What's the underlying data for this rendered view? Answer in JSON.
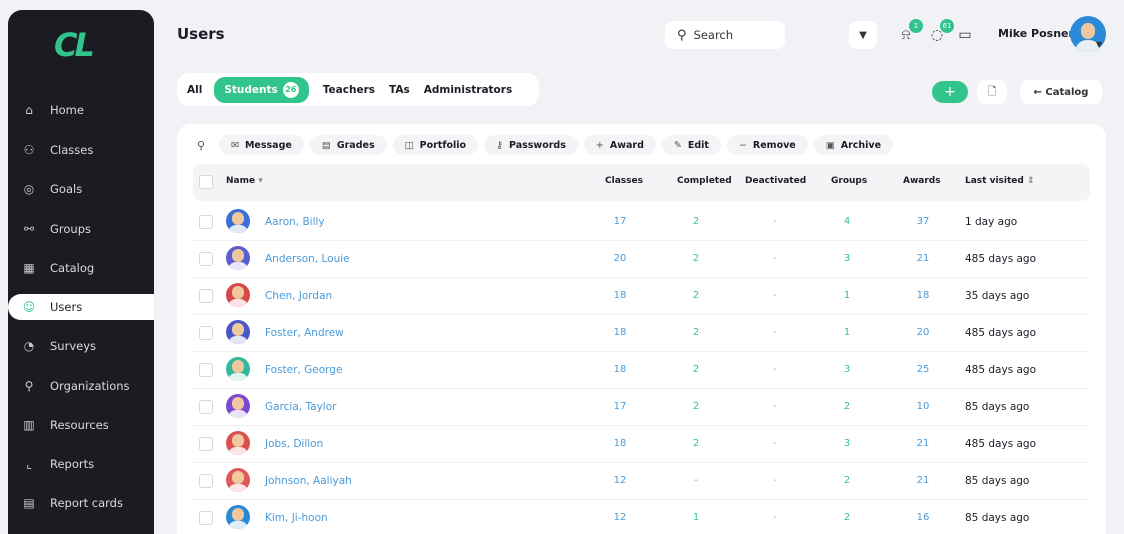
{
  "app": {
    "logo": "CL",
    "page_title": "Users"
  },
  "sidebar": {
    "items": [
      {
        "label": "Home",
        "icon": "home-icon",
        "glyph": "⌂"
      },
      {
        "label": "Classes",
        "icon": "classes-icon",
        "glyph": "⚇"
      },
      {
        "label": "Goals",
        "icon": "goals-icon",
        "glyph": "◎"
      },
      {
        "label": "Groups",
        "icon": "groups-icon",
        "glyph": "⚯"
      },
      {
        "label": "Catalog",
        "icon": "catalog-icon",
        "glyph": "▦"
      },
      {
        "label": "Users",
        "icon": "user-icon",
        "glyph": "☺",
        "active": true
      },
      {
        "label": "Surveys",
        "icon": "surveys-icon",
        "glyph": "◔"
      },
      {
        "label": "Organizations",
        "icon": "organizations-icon",
        "glyph": "⚲"
      },
      {
        "label": "Resources",
        "icon": "resources-icon",
        "glyph": "▥"
      },
      {
        "label": "Reports",
        "icon": "reports-icon",
        "glyph": "⌞"
      },
      {
        "label": "Report cards",
        "icon": "report-cards-icon",
        "glyph": "▤"
      }
    ]
  },
  "header": {
    "search_label": "Search",
    "user_name": "Mike Posner",
    "notif_badge_1": "1",
    "notif_badge_2": "61"
  },
  "role_tabs": {
    "all": "All",
    "students": "Students",
    "students_count": "26",
    "teachers": "Teachers",
    "tas": "TAs",
    "administrators": "Administrators"
  },
  "actions": {
    "add": "+",
    "catalog": "← Catalog"
  },
  "toolbar": {
    "message": "Message",
    "grades": "Grades",
    "portfolio": "Portfolio",
    "passwords": "Passwords",
    "award": "Award",
    "edit": "Edit",
    "remove": "Remove",
    "archive": "Archive"
  },
  "table": {
    "headers": {
      "name": "Name",
      "classes": "Classes",
      "completed": "Completed",
      "deactivated": "Deactivated",
      "groups": "Groups",
      "awards": "Awards",
      "last_visited": "Last visited"
    },
    "rows": [
      {
        "name": "Aaron, Billy",
        "classes": "17",
        "completed": "2",
        "deactivated": "-",
        "groups": "4",
        "awards": "37",
        "last_visited": "1 day ago",
        "color": "#3b6fd8"
      },
      {
        "name": "Anderson, Louie",
        "classes": "20",
        "completed": "2",
        "deactivated": "-",
        "groups": "3",
        "awards": "21",
        "last_visited": "485 days ago",
        "color": "#5a5fd0"
      },
      {
        "name": "Chen, Jordan",
        "classes": "18",
        "completed": "2",
        "deactivated": "-",
        "groups": "1",
        "awards": "18",
        "last_visited": "35 days ago",
        "color": "#d84848"
      },
      {
        "name": "Foster, Andrew",
        "classes": "18",
        "completed": "2",
        "deactivated": "-",
        "groups": "1",
        "awards": "20",
        "last_visited": "485 days ago",
        "color": "#4a55c8"
      },
      {
        "name": "Foster, George",
        "classes": "18",
        "completed": "2",
        "deactivated": "-",
        "groups": "3",
        "awards": "25",
        "last_visited": "485 days ago",
        "color": "#32b89a"
      },
      {
        "name": "Garcia, Taylor",
        "classes": "17",
        "completed": "2",
        "deactivated": "-",
        "groups": "2",
        "awards": "10",
        "last_visited": "85 days ago",
        "color": "#7a4ad0"
      },
      {
        "name": "Jobs, Dillon",
        "classes": "18",
        "completed": "2",
        "deactivated": "-",
        "groups": "3",
        "awards": "21",
        "last_visited": "485 days ago",
        "color": "#d85050"
      },
      {
        "name": "Johnson, Aaliyah",
        "classes": "12",
        "completed": "-",
        "deactivated": "-",
        "groups": "2",
        "awards": "21",
        "last_visited": "85 days ago",
        "color": "#e05a5a"
      },
      {
        "name": "Kim, Ji-hoon",
        "classes": "12",
        "completed": "1",
        "deactivated": "-",
        "groups": "2",
        "awards": "16",
        "last_visited": "85 days ago",
        "color": "#2b8ad8"
      }
    ]
  },
  "colors": {
    "accent": "#32c48d",
    "link": "#4a9ad8",
    "sidebar_bg": "#1b1b22"
  }
}
